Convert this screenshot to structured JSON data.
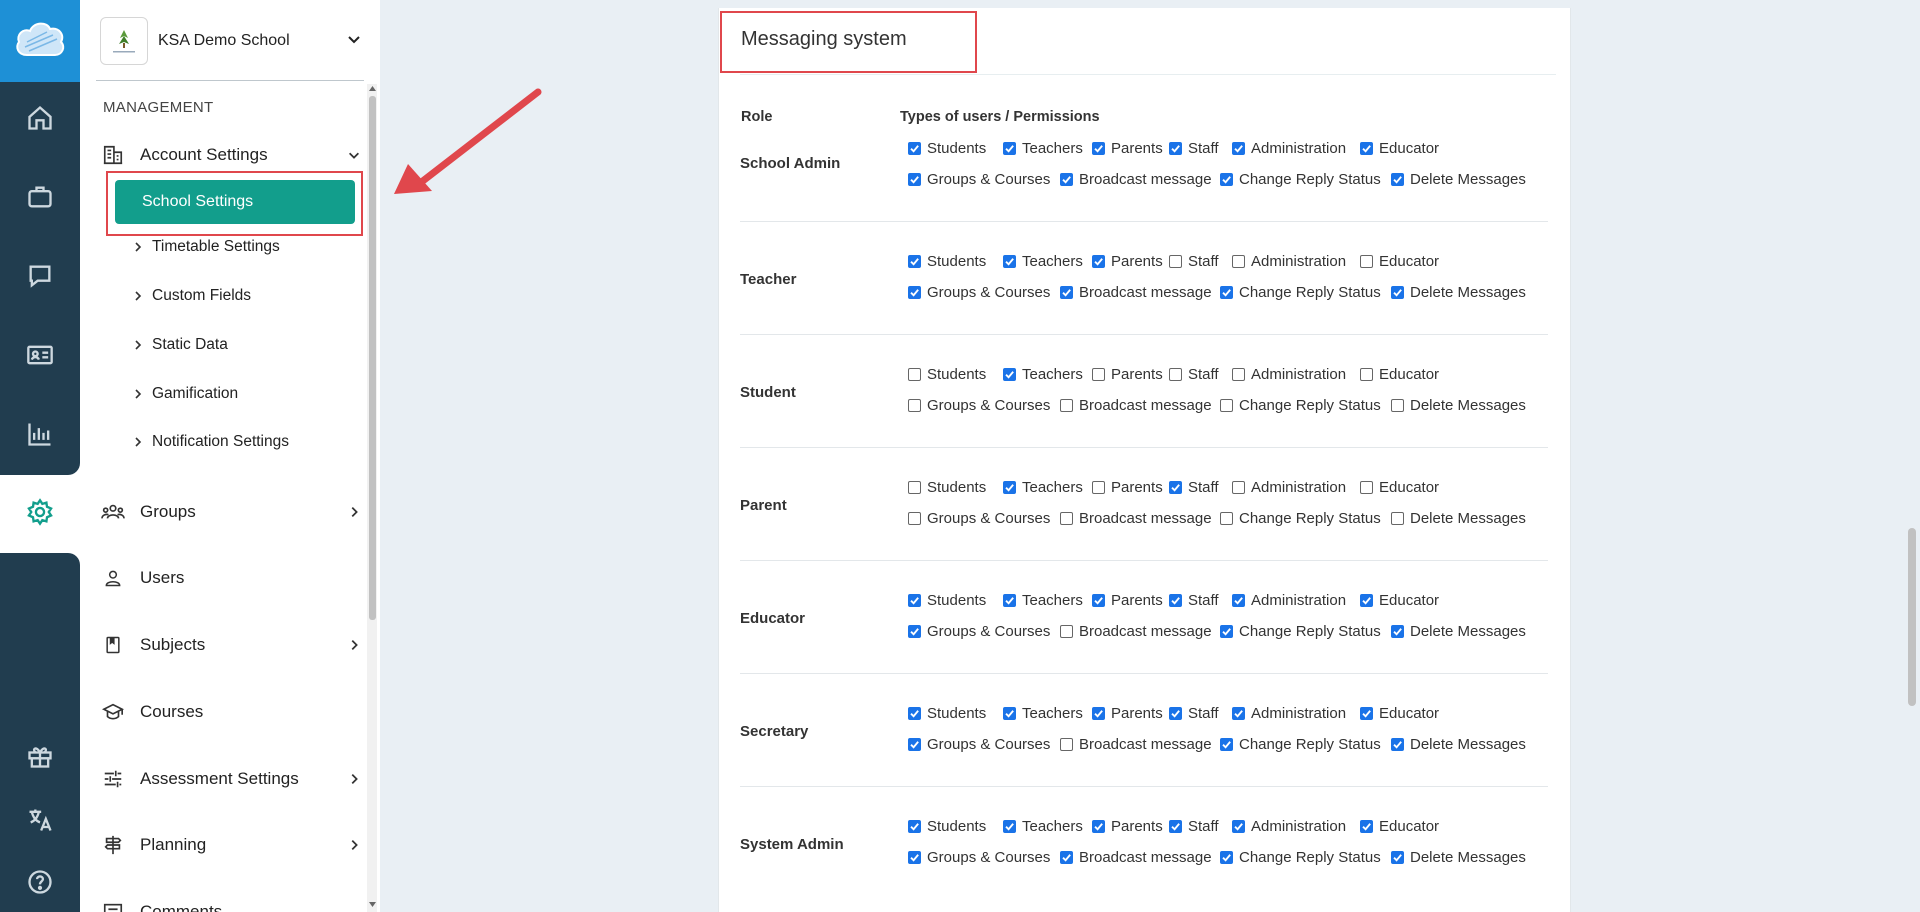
{
  "sidebar": {
    "school_name": "KSA Demo School",
    "section_label": "MANAGEMENT",
    "account_settings": "Account Settings",
    "active_item": "School Settings",
    "sub_items": [
      "Timetable Settings",
      "Custom Fields",
      "Static Data",
      "Gamification",
      "Notification Settings"
    ],
    "groups": "Groups",
    "users": "Users",
    "subjects": "Subjects",
    "courses": "Courses",
    "assessment_settings": "Assessment Settings",
    "planning": "Planning",
    "comments": "Comments"
  },
  "rail": {
    "icons": [
      "cloud-logo-icon",
      "home-icon",
      "briefcase-icon",
      "chat-icon",
      "id-card-icon",
      "bar-chart-icon",
      "settings-gear-icon",
      "gift-icon",
      "translate-icon",
      "help-icon"
    ]
  },
  "panel": {
    "title": "Messaging system",
    "col_role": "Role",
    "col_perms": "Types of users / Permissions"
  },
  "permission_labels": [
    "Students",
    "Teachers",
    "Parents",
    "Staff",
    "Administration",
    "Educator",
    "Groups & Courses",
    "Broadcast message",
    "Change Reply Status",
    "Delete Messages"
  ],
  "roles": [
    {
      "name": "School Admin",
      "checked": [
        true,
        true,
        true,
        true,
        true,
        true,
        true,
        true,
        true,
        true
      ]
    },
    {
      "name": "Teacher",
      "checked": [
        true,
        true,
        true,
        false,
        false,
        false,
        true,
        true,
        true,
        true
      ]
    },
    {
      "name": "Student",
      "checked": [
        false,
        true,
        false,
        false,
        false,
        false,
        false,
        false,
        false,
        false
      ]
    },
    {
      "name": "Parent",
      "checked": [
        false,
        true,
        false,
        true,
        false,
        false,
        false,
        false,
        false,
        false
      ]
    },
    {
      "name": "Educator",
      "checked": [
        true,
        true,
        true,
        true,
        true,
        true,
        true,
        false,
        true,
        true
      ]
    },
    {
      "name": "Secretary",
      "checked": [
        true,
        true,
        true,
        true,
        true,
        true,
        true,
        false,
        true,
        true
      ]
    },
    {
      "name": "System Admin",
      "checked": [
        true,
        true,
        true,
        true,
        true,
        true,
        true,
        true,
        true,
        true
      ]
    }
  ],
  "colors": {
    "accent_teal": "#129e8c",
    "rail_dark": "#213d4f",
    "rail_top": "#1e90d6",
    "checkbox_blue": "#1a73e8",
    "annotation_red": "#e0474c"
  }
}
